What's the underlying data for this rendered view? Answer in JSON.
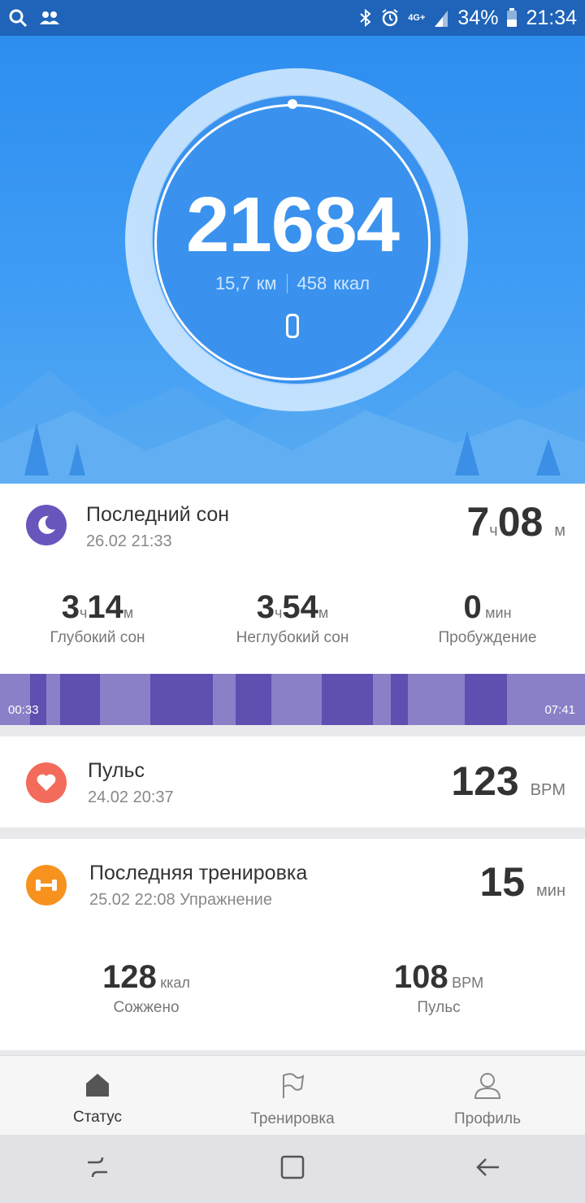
{
  "status_bar": {
    "battery": "34%",
    "time": "21:34",
    "network": "4G+",
    "icons": [
      "search-icon",
      "contacts-icon",
      "bluetooth-icon",
      "alarm-icon",
      "network-icon",
      "signal-icon",
      "battery-icon"
    ]
  },
  "hero": {
    "steps": "21684",
    "distance": "15,7",
    "distance_unit": "км",
    "calories": "458",
    "calories_unit": "ккал"
  },
  "sleep": {
    "title": "Последний сон",
    "date": "26.02 21:33",
    "total_h": "7",
    "total_h_unit": "ч",
    "total_m": "08",
    "total_m_unit": "м",
    "deep": {
      "h": "3",
      "h_unit": "ч",
      "m": "14",
      "m_unit": "м",
      "label": "Глубокий сон"
    },
    "light": {
      "h": "3",
      "h_unit": "ч",
      "m": "54",
      "m_unit": "м",
      "label": "Неглубокий сон"
    },
    "awake": {
      "value": "0",
      "unit": "мин",
      "label": "Пробуждение"
    },
    "start_time": "00:33",
    "end_time": "07:41",
    "colors": {
      "light": "#8a80c8",
      "deep": "#5e4fb0",
      "icon": "#6a55bd"
    }
  },
  "pulse": {
    "title": "Пульс",
    "date": "24.02 20:37",
    "value": "123",
    "unit": "BPM",
    "icon_color": "#f26b5b"
  },
  "training": {
    "title": "Последняя тренировка",
    "date": "25.02 22:08 Упражнение",
    "duration": "15",
    "duration_unit": "мин",
    "calories": "128",
    "calories_unit": "ккал",
    "calories_label": "Сожжено",
    "heart": "108",
    "heart_unit": "BPM",
    "heart_label": "Пульс",
    "icon_color": "#f7921e"
  },
  "bottom_nav": {
    "items": [
      {
        "label": "Статус",
        "icon": "home-icon",
        "active": true
      },
      {
        "label": "Тренировка",
        "icon": "flag-icon",
        "active": false
      },
      {
        "label": "Профиль",
        "icon": "profile-icon",
        "active": false
      }
    ]
  },
  "system_nav": {
    "icons": [
      "recent-apps-icon",
      "home-button-icon",
      "back-icon"
    ]
  }
}
